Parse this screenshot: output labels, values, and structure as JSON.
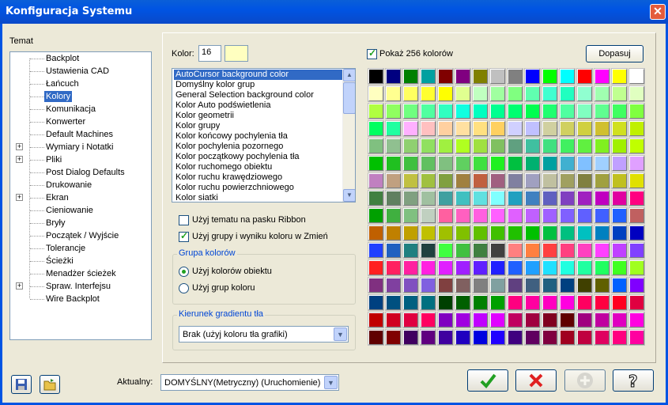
{
  "window": {
    "title": "Konfiguracja Systemu",
    "close_label": "✕"
  },
  "tree": {
    "label": "Temat",
    "items": [
      {
        "label": "Backplot",
        "expander": false,
        "selected": false
      },
      {
        "label": "Ustawienia CAD",
        "expander": false,
        "selected": false
      },
      {
        "label": "Łańcuch",
        "expander": false,
        "selected": false
      },
      {
        "label": "Kolory",
        "expander": false,
        "selected": true
      },
      {
        "label": "Komunikacja",
        "expander": false,
        "selected": false
      },
      {
        "label": "Konwerter",
        "expander": false,
        "selected": false
      },
      {
        "label": "Default Machines",
        "expander": false,
        "selected": false
      },
      {
        "label": "Wymiary i Notatki",
        "expander": true,
        "selected": false
      },
      {
        "label": "Pliki",
        "expander": true,
        "selected": false
      },
      {
        "label": "Post Dialog Defaults",
        "expander": false,
        "selected": false
      },
      {
        "label": "Drukowanie",
        "expander": false,
        "selected": false
      },
      {
        "label": "Ekran",
        "expander": true,
        "selected": false
      },
      {
        "label": "Cieniowanie",
        "expander": false,
        "selected": false
      },
      {
        "label": "Bryły",
        "expander": false,
        "selected": false
      },
      {
        "label": "Początek / Wyjście",
        "expander": false,
        "selected": false
      },
      {
        "label": "Tolerancje",
        "expander": false,
        "selected": false
      },
      {
        "label": "Ścieżki",
        "expander": false,
        "selected": false
      },
      {
        "label": "Menadżer ścieżek",
        "expander": false,
        "selected": false
      },
      {
        "label": "Spraw. Interfejsu",
        "expander": true,
        "selected": false
      },
      {
        "label": "Wire Backplot",
        "expander": false,
        "selected": false
      }
    ]
  },
  "color": {
    "label": "Kolor:",
    "value": "16",
    "swatch": "#ffffc0"
  },
  "list": {
    "items": [
      "AutoCursor background color",
      "Domyślny kolor grup",
      "General Selection background color",
      "Kolor Auto podświetlenia",
      "Kolor geometrii",
      "Kolor grupy",
      "Kolor końcowy pochylenia tła",
      "Kolor pochylenia pozornego",
      "Kolor początkowy pochylenia tła",
      "Kolor ruchomego obiektu",
      "Kolor ruchu krawędziowego",
      "Kolor ruchu powierzchniowego",
      "Kolor siatki"
    ],
    "selected_index": 0
  },
  "checks": {
    "ribbon": {
      "label": "Użyj tematu na pasku Ribbon",
      "checked": false
    },
    "groups": {
      "label": "Użyj grupy i wyniku koloru w Zmień",
      "checked": true
    },
    "show256": {
      "label": "Pokaż 256 kolorów",
      "checked": true
    }
  },
  "group_colors": {
    "title": "Grupa kolorów",
    "options": [
      {
        "label": "Użyj kolorów obiektu",
        "selected": true
      },
      {
        "label": "Użyj grup koloru",
        "selected": false
      }
    ]
  },
  "gradient": {
    "title": "Kierunek gradientu tła",
    "value": "Brak (użyj koloru tła grafiki)"
  },
  "dopasuj_label": "Dopasuj",
  "current": {
    "label": "Aktualny:",
    "value": "DOMYŚLNY(Metryczny) (Uruchomienie)"
  },
  "icons": {
    "save": "save-icon",
    "open": "open-folder-icon",
    "ok": "check-icon",
    "cancel": "x-icon",
    "add": "plus-icon",
    "help": "help-icon"
  },
  "palette_rows": [
    [
      "#000000",
      "#000080",
      "#008000",
      "#00a0a0",
      "#800000",
      "#800080",
      "#808000",
      "#c0c0c0",
      "#808080",
      "#0000ff",
      "#00ff00",
      "#00ffff",
      "#ff0000",
      "#ff00ff",
      "#ffff00",
      "#ffffff"
    ],
    [
      "#ffffc0",
      "#ffff90",
      "#ffff60",
      "#ffff30",
      "#ffff00",
      "#e0ff90",
      "#c0ffc0",
      "#a0ffa0",
      "#80ff80",
      "#60ffb0",
      "#40ffd0",
      "#20ffc0",
      "#90ffd0",
      "#a0ffb0",
      "#c0ff90",
      "#e0ffc0"
    ],
    [
      "#b0ff40",
      "#90ff60",
      "#70ff80",
      "#50ffa0",
      "#30ffc0",
      "#10ffe0",
      "#00ffc0",
      "#00ff90",
      "#00ff70",
      "#00ff50",
      "#20ff70",
      "#50ffa0",
      "#80ffc0",
      "#60ff90",
      "#40ff60",
      "#80ff40"
    ],
    [
      "#00ff60",
      "#20ffa0",
      "#ffb0ff",
      "#ffc0c0",
      "#ffd0a0",
      "#ffe0a0",
      "#ffe080",
      "#ffd060",
      "#d0d0ff",
      "#c0c0ff",
      "#d0d0a0",
      "#d0d060",
      "#d0d040",
      "#d0c030",
      "#d0e020",
      "#c0f000"
    ],
    [
      "#80c080",
      "#90c090",
      "#90d070",
      "#90e060",
      "#a0f040",
      "#b0ff20",
      "#a0e040",
      "#80c060",
      "#60a080",
      "#40c0a0",
      "#40e080",
      "#40f060",
      "#60f040",
      "#80f020",
      "#a0f000",
      "#c0ff00"
    ],
    [
      "#00c000",
      "#20c020",
      "#40c040",
      "#60c060",
      "#80c080",
      "#60d060",
      "#40e040",
      "#20f020",
      "#00c040",
      "#00b070",
      "#00a0a0",
      "#40b0d0",
      "#80c0ff",
      "#a0d0ff",
      "#c0a0ff",
      "#e0a0ff"
    ],
    [
      "#c080c0",
      "#c0a080",
      "#c0c040",
      "#a0c040",
      "#80a040",
      "#a08040",
      "#c06040",
      "#a06080",
      "#8080a0",
      "#a0a0c0",
      "#c0c0a0",
      "#a0a060",
      "#808040",
      "#a0a040",
      "#c0c020",
      "#e0e000"
    ],
    [
      "#408040",
      "#608060",
      "#80a080",
      "#a0c0a0",
      "#40a0a0",
      "#40c0c0",
      "#60e0e0",
      "#80ffff",
      "#20a0c0",
      "#4080c0",
      "#6060c0",
      "#8040c0",
      "#a020c0",
      "#c000c0",
      "#e000a0",
      "#ff0080"
    ],
    [
      "#00a000",
      "#40b040",
      "#80c080",
      "#c0d0c0",
      "#ff60a0",
      "#ff60c0",
      "#ff60e0",
      "#ff60ff",
      "#e060ff",
      "#c060ff",
      "#a060ff",
      "#8060ff",
      "#6060ff",
      "#4060ff",
      "#2060ff",
      "#c06060"
    ],
    [
      "#c06000",
      "#c08000",
      "#c0a000",
      "#c0c000",
      "#a0c000",
      "#80c000",
      "#60c000",
      "#40c000",
      "#20c000",
      "#00c000",
      "#00c040",
      "#00c080",
      "#00c0c0",
      "#0080c0",
      "#0040c0",
      "#0000c0"
    ],
    [
      "#2040ff",
      "#2060c0",
      "#208080",
      "#204040",
      "#40ff40",
      "#40c040",
      "#408040",
      "#404040",
      "#ff8080",
      "#ff8040",
      "#ff4040",
      "#ff4080",
      "#ff40c0",
      "#ff40ff",
      "#c040ff",
      "#8040ff"
    ],
    [
      "#ff2020",
      "#ff2060",
      "#ff20a0",
      "#ff20e0",
      "#e020ff",
      "#a020ff",
      "#6020ff",
      "#2020ff",
      "#2060ff",
      "#20a0ff",
      "#20e0ff",
      "#20ffe0",
      "#20ffa0",
      "#20ff60",
      "#40ff20",
      "#a0ff20"
    ],
    [
      "#803080",
      "#8040a0",
      "#8050c0",
      "#8060e0",
      "#804040",
      "#806060",
      "#808080",
      "#80a0a0",
      "#604080",
      "#406080",
      "#206080",
      "#004080",
      "#404000",
      "#606000",
      "#0060ff",
      "#8000ff"
    ],
    [
      "#004080",
      "#005080",
      "#006080",
      "#007080",
      "#004000",
      "#006000",
      "#008000",
      "#00a000",
      "#ff0080",
      "#ff00a0",
      "#ff00c0",
      "#ff00e0",
      "#ff0060",
      "#ff0040",
      "#ff0020",
      "#e00040"
    ],
    [
      "#c00000",
      "#d00020",
      "#e00040",
      "#ff0060",
      "#8000c0",
      "#a000e0",
      "#c000ff",
      "#e000ff",
      "#c00060",
      "#a00040",
      "#800020",
      "#600000",
      "#a00080",
      "#c000a0",
      "#e000c0",
      "#ff00e0"
    ],
    [
      "#600000",
      "#800000",
      "#400060",
      "#600080",
      "#4000a0",
      "#2000c0",
      "#0000e0",
      "#2000ff",
      "#400080",
      "#600060",
      "#800040",
      "#a00020",
      "#c00040",
      "#e00060",
      "#ff0080",
      "#ff00a0"
    ]
  ]
}
